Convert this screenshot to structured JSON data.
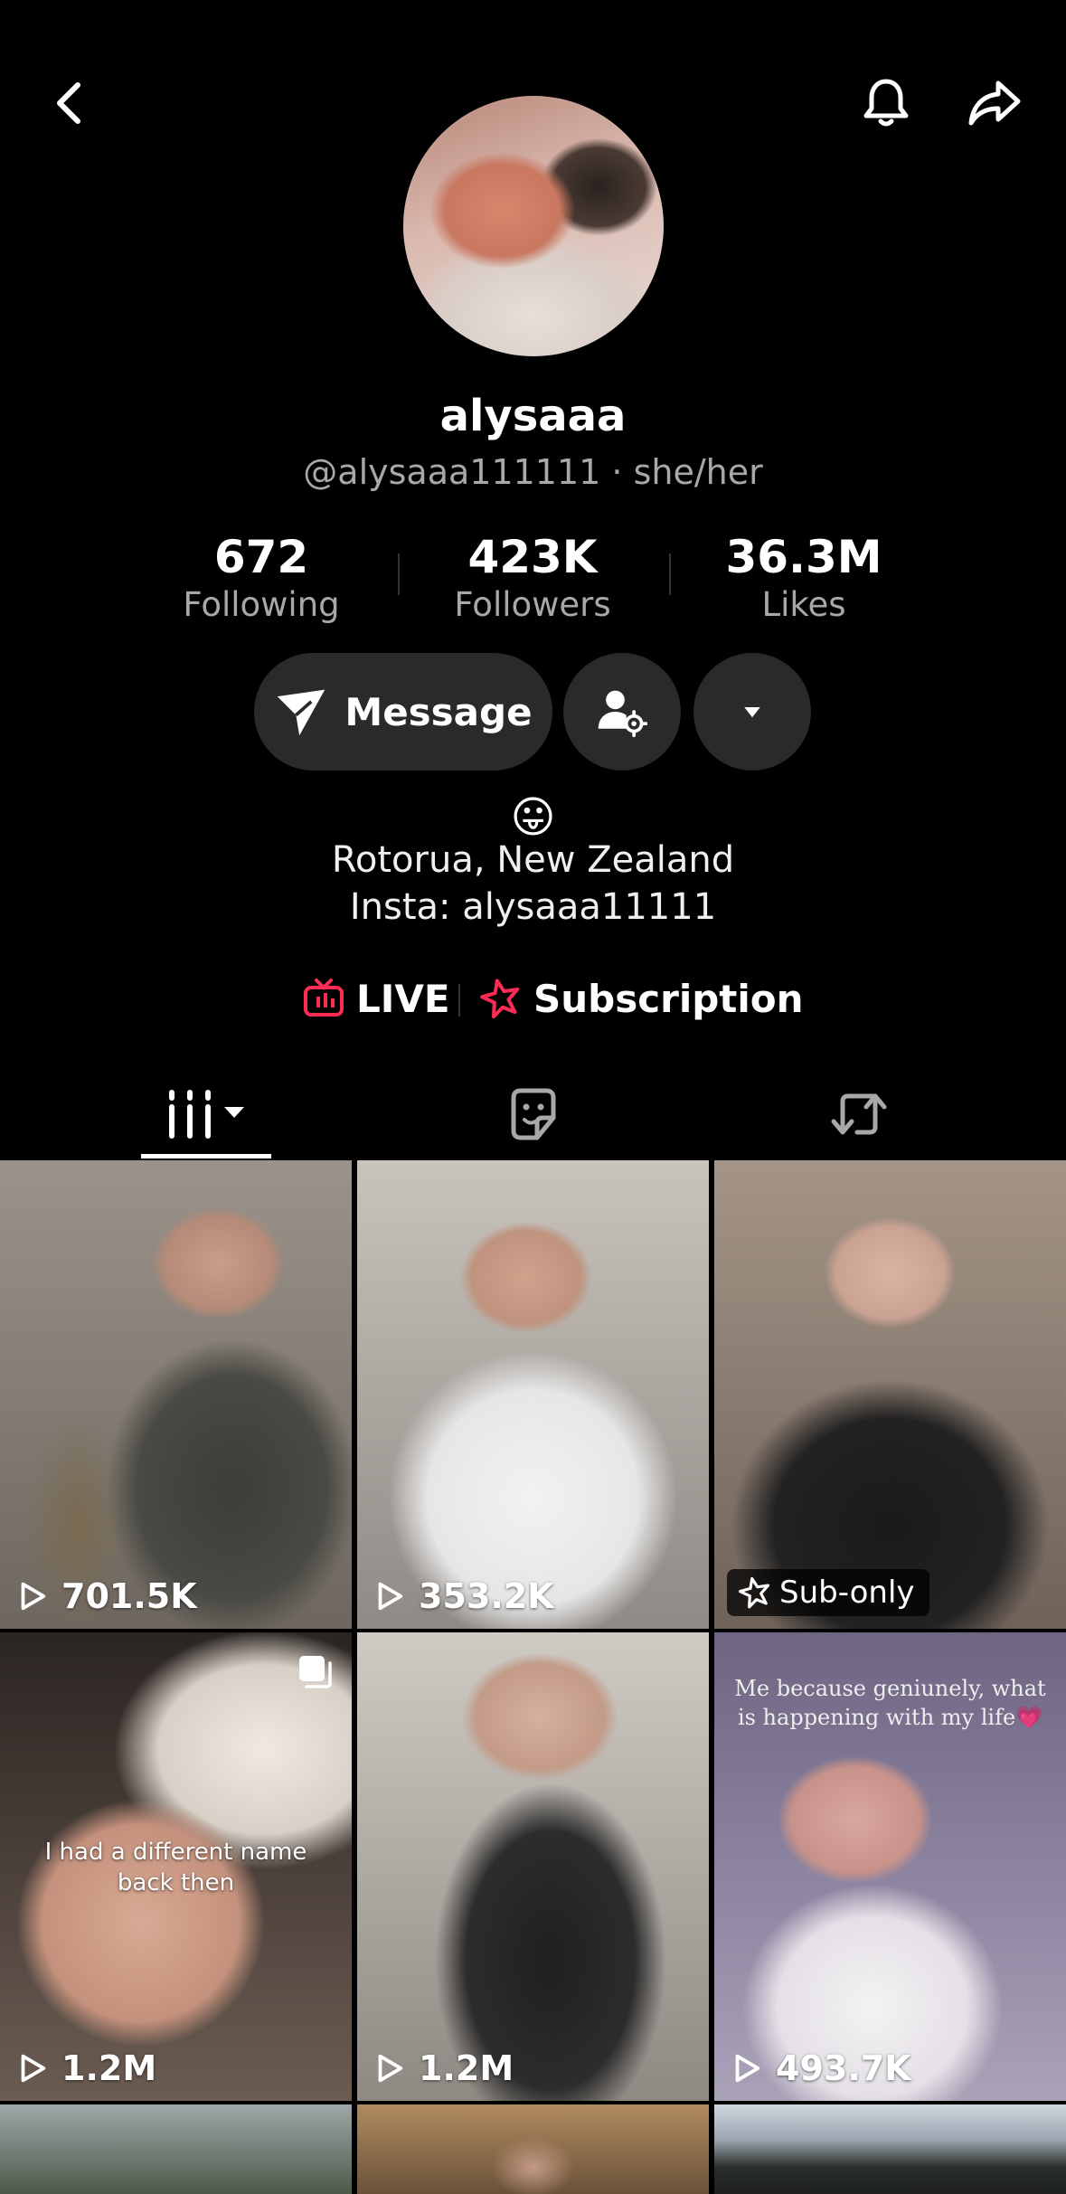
{
  "profile": {
    "display_name": "alysaaa",
    "handle_line": "@alysaaa111111 · she/her",
    "stats": [
      {
        "value": "672",
        "label": "Following"
      },
      {
        "value": "423K",
        "label": "Followers"
      },
      {
        "value": "36.3M",
        "label": "Likes"
      }
    ],
    "bio": {
      "emoji": "😛",
      "location": "Rotorua, New Zealand",
      "insta": "Insta: alysaaa11111"
    }
  },
  "actions": {
    "message_label": "Message"
  },
  "links": {
    "live": "LIVE",
    "subscription": "Subscription"
  },
  "colors": {
    "background": "#000000",
    "button_bg": "#2a2a2a",
    "muted_text": "#a8a8a8",
    "accent_red": "#fe2c55"
  },
  "icons": {
    "back": "chevron-left-icon",
    "bell": "bell-icon",
    "share": "share-arrow-icon",
    "message": "paper-plane-icon",
    "person_settings": "person-gear-icon",
    "more": "caret-down-icon",
    "live": "tv-live-icon",
    "subscription": "star-icon",
    "tab_videos": "grid-columns-icon",
    "tab_favorites": "sticker-icon",
    "tab_reposts": "repost-icon"
  },
  "videos": [
    {
      "views": "701.5K"
    },
    {
      "views": "353.2K"
    },
    {
      "badge": "Sub-only"
    },
    {
      "views": "1.2M",
      "overlay": "I had a different name back then"
    },
    {
      "views": "1.2M"
    },
    {
      "views": "493.7K",
      "caption": "Me because geniunely, what is happening with my life💗"
    }
  ]
}
